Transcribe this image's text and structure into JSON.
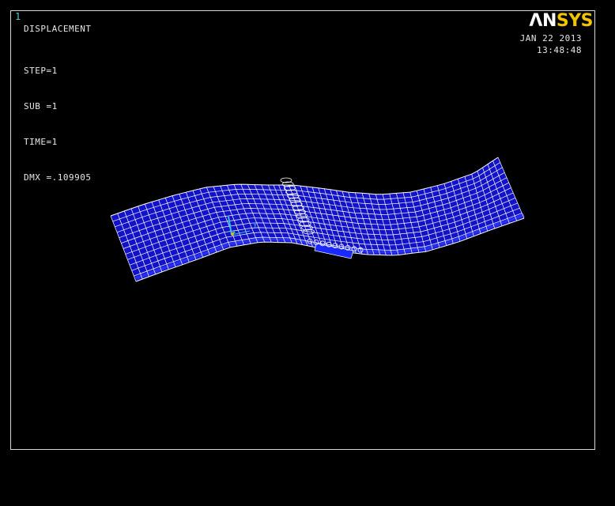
{
  "window": {
    "number": "1"
  },
  "plot": {
    "title": "DISPLACEMENT",
    "info": [
      "STEP=1",
      "SUB =1",
      "TIME=1",
      "DMX =.109905"
    ]
  },
  "header": {
    "date": "JAN 22 2013",
    "time": "13:48:48"
  },
  "logo": {
    "part1": "ΛN",
    "part2": "SYS"
  },
  "triad": {
    "label": "Y"
  },
  "colors": {
    "background": "#000000",
    "mesh_fill": "#1212c8",
    "mesh_lines": "#ffffff",
    "border": "#d8d8d8",
    "logo_yellow": "#f0c400",
    "window_number": "#4fd0c8"
  }
}
